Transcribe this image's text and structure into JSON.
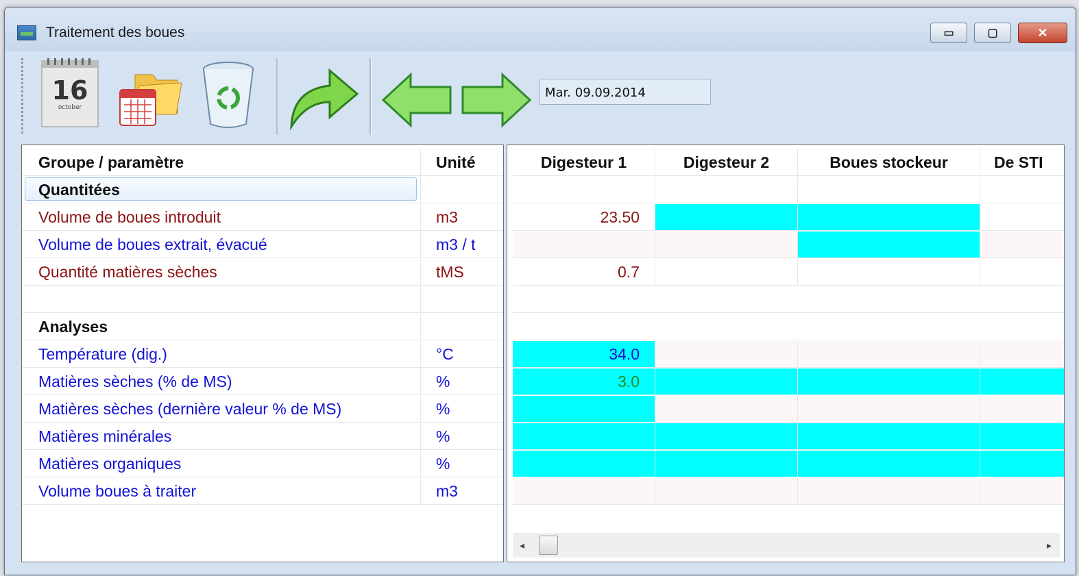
{
  "window": {
    "title": "Traitement des boues",
    "controls": {
      "minimize": "▭",
      "maximize": "▢",
      "close": "✕"
    }
  },
  "toolbar": {
    "calendar_day": "16",
    "calendar_month": "october",
    "date_value": "Mar. 09.09.2014",
    "icons": [
      "calendar-icon",
      "open-folder-calendar-icon",
      "recycle-bin-icon",
      "forward-arrow-icon",
      "previous-arrow-icon",
      "next-arrow-icon"
    ]
  },
  "left_grid": {
    "headers": {
      "param": "Groupe / paramètre",
      "unit": "Unité"
    },
    "rows": [
      {
        "type": "group",
        "label": "Quantitées",
        "unit": ""
      },
      {
        "type": "param",
        "label": "Volume de boues introduit",
        "unit": "m3",
        "color": "red"
      },
      {
        "type": "param",
        "label": "Volume de boues extrait, évacué",
        "unit": "m3 / t",
        "color": "blue"
      },
      {
        "type": "param",
        "label": "Quantité matières sèches",
        "unit": "tMS",
        "color": "red"
      },
      {
        "type": "blank",
        "label": "",
        "unit": ""
      },
      {
        "type": "group",
        "label": "Analyses",
        "unit": ""
      },
      {
        "type": "param",
        "label": "Température (dig.)",
        "unit": "°C",
        "color": "blue"
      },
      {
        "type": "param",
        "label": "Matières sèches (% de MS)",
        "unit": "%",
        "color": "blue"
      },
      {
        "type": "param",
        "label": "Matières sèches (dernière valeur % de MS)",
        "unit": "%",
        "color": "blue"
      },
      {
        "type": "param",
        "label": "Matières minérales",
        "unit": "%",
        "color": "blue"
      },
      {
        "type": "param",
        "label": "Matières organiques",
        "unit": "%",
        "color": "blue"
      },
      {
        "type": "param",
        "label": "Volume boues à traiter",
        "unit": "m3",
        "color": "blue"
      }
    ]
  },
  "right_grid": {
    "headers": [
      "Digesteur 1",
      "Digesteur 2",
      "Boues stockeur",
      "De STI"
    ],
    "values": {
      "volume_introduit_d1": "23.50",
      "quantite_ms_d1": "0.7",
      "temperature_d1": "34.0",
      "ms_pct_d1": "3.0"
    },
    "colors": {
      "cyan": "#00ffff",
      "pink": "#fdf6f6"
    }
  },
  "scrollbar": {
    "left": "◂",
    "right": "▸"
  }
}
